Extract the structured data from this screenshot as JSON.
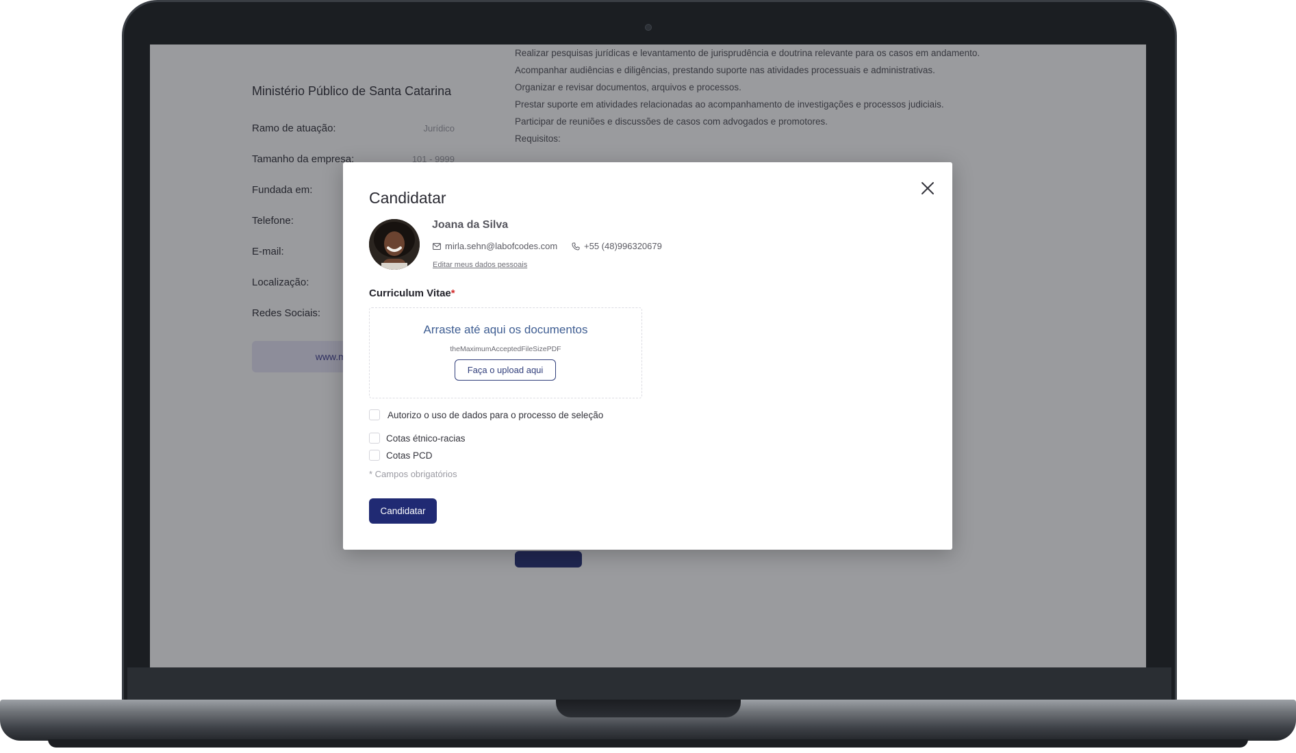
{
  "background_page": {
    "company": {
      "name": "Ministério Público de Santa Catarina",
      "fields": [
        {
          "label": "Ramo de atuação:",
          "value": "Jurídico"
        },
        {
          "label": "Tamanho da empresa:",
          "value": "101 - 9999"
        },
        {
          "label": "Fundada em:",
          "value": ""
        },
        {
          "label": "Telefone:",
          "value": ""
        },
        {
          "label": "E-mail:",
          "value": ""
        },
        {
          "label": "Localização:",
          "value": ""
        },
        {
          "label": "Redes Sociais:",
          "value": ""
        }
      ],
      "website_label": "www.mpsc.mp.br"
    },
    "description_lines": [
      "Realizar pesquisas jurídicas e levantamento de jurisprudência e doutrina relevante para os casos em andamento.",
      "Acompanhar audiências e diligências, prestando suporte nas atividades processuais e administrativas.",
      "Organizar e revisar documentos, arquivos e processos.",
      "Prestar suporte em atividades relacionadas ao acompanhamento de investigações e processos judiciais.",
      "Participar de reuniões e discussões de casos com advogados e promotores.",
      "Requisitos:"
    ]
  },
  "modal": {
    "title": "Candidatar",
    "close_icon": "close-icon",
    "user": {
      "name": "Joana da Silva",
      "email": "mirla.sehn@labofcodes.com",
      "phone": "+55 (48)996320679",
      "edit_link": "Editar meus dados pessoais"
    },
    "cv": {
      "label": "Curriculum Vitae",
      "required_mark": "*",
      "drop_title": "Arraste até aqui os documentos",
      "drop_subtitle": "theMaximumAcceptedFileSizePDF",
      "upload_button": "Faça o upload aqui"
    },
    "checkboxes": {
      "autorizo": "Autorizo o uso de dados para o processo de seleção",
      "etnico": "Cotas étnico-racias",
      "pcd": "Cotas PCD"
    },
    "required_note": "* Campos obrigatórios",
    "submit_button": "Candidatar"
  },
  "colors": {
    "primary": "#202a73",
    "link_blue": "#3e5d92",
    "required": "#d22b2b"
  }
}
